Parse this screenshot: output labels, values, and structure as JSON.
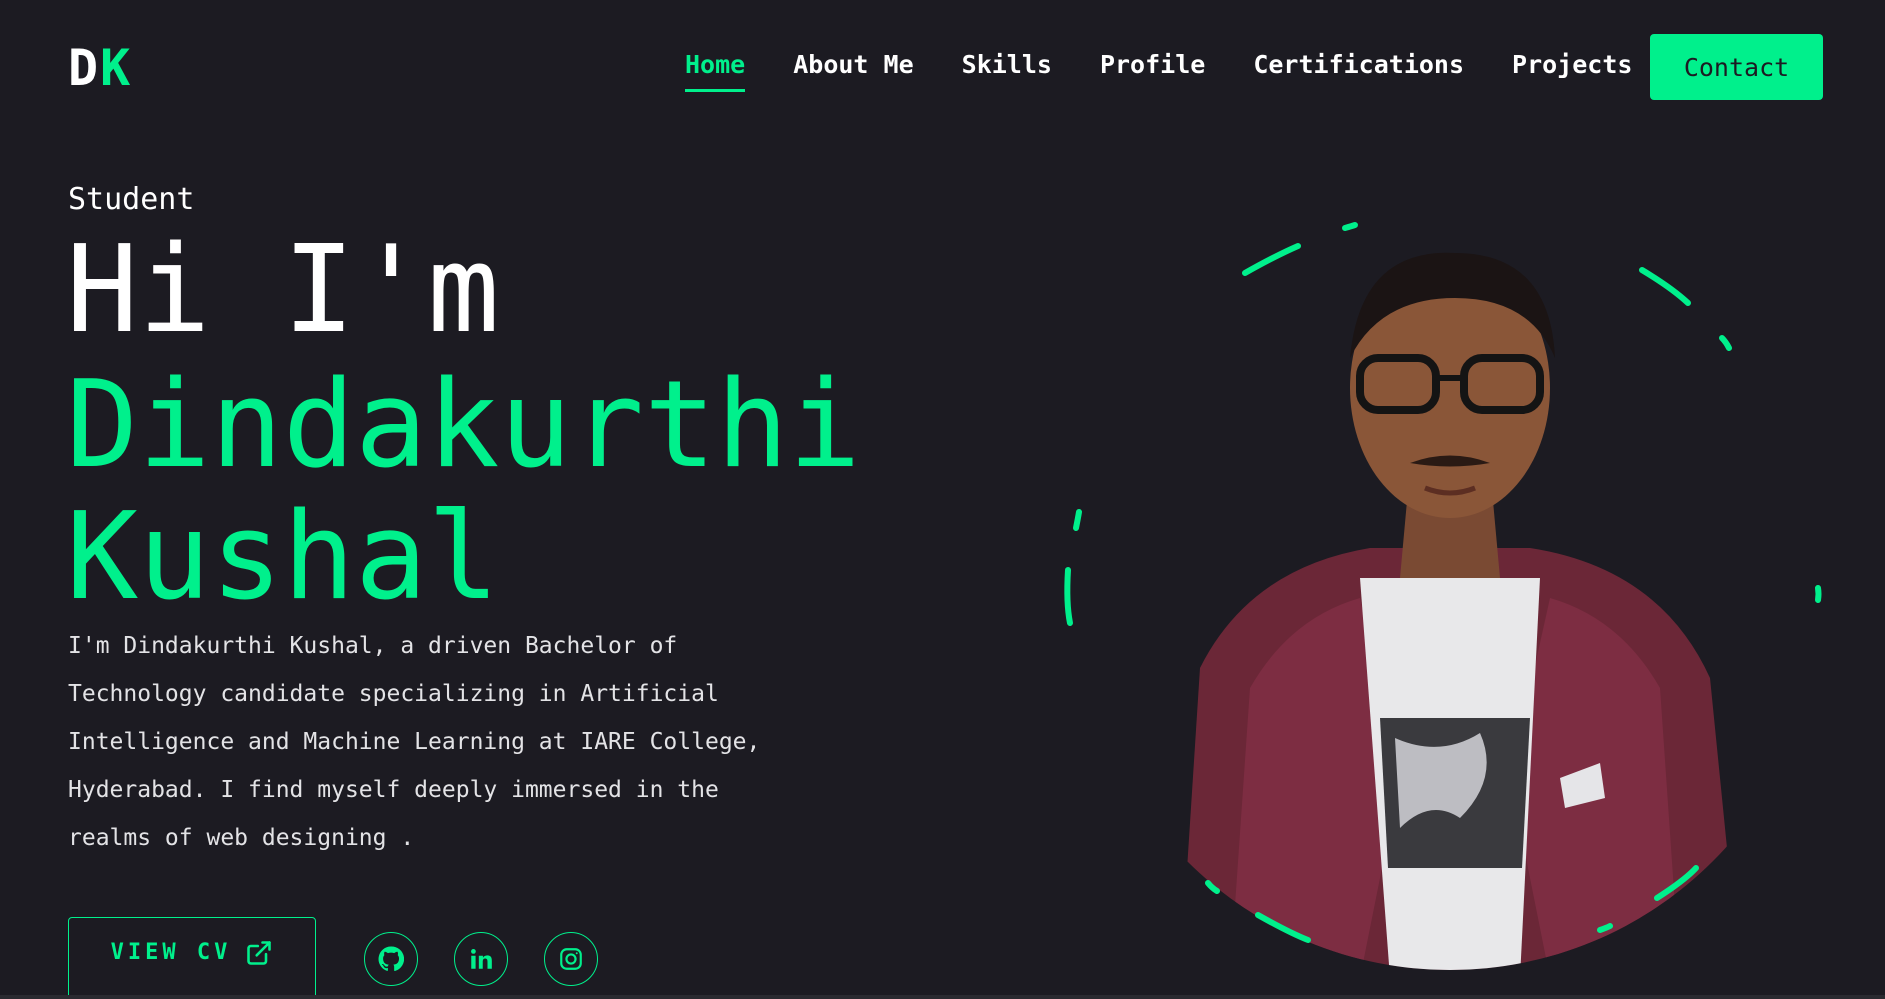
{
  "header": {
    "logo_first": "D",
    "logo_second": "K",
    "nav": [
      {
        "label": "Home",
        "active": true
      },
      {
        "label": "About Me",
        "active": false
      },
      {
        "label": "Skills",
        "active": false
      },
      {
        "label": "Profile",
        "active": false
      },
      {
        "label": "Certifications",
        "active": false
      },
      {
        "label": "Projects",
        "active": false
      }
    ],
    "contact_label": "Contact"
  },
  "hero": {
    "subtitle": "Student",
    "greeting": "Hi I'm",
    "name_line1": "Dindakurthi",
    "name_line2": "Kushal",
    "bio": "I'm Dindakurthi Kushal, a driven Bachelor of Technology candidate specializing in Artificial Intelligence and Machine Learning at IARE College, Hyderabad. I find myself deeply immersed in the realms of web designing .",
    "cv_label": "VIEW CV",
    "cv_icon": "external-link-icon",
    "socials": [
      {
        "name": "github",
        "icon": "github-icon"
      },
      {
        "name": "linkedin",
        "icon": "linkedin-icon"
      },
      {
        "name": "instagram",
        "icon": "instagram-icon"
      }
    ]
  },
  "colors": {
    "background": "#1c1b22",
    "accent": "#00f08c",
    "text": "#ffffff"
  }
}
